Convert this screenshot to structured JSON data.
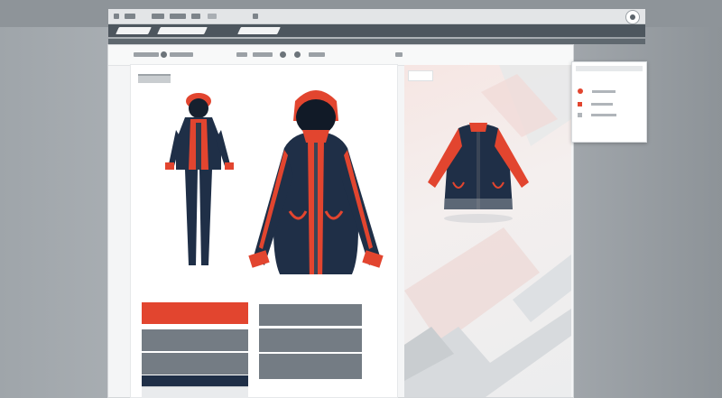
{
  "app": {
    "toolbar_chips": 7,
    "nav_pills": 3
  },
  "colors": {
    "accent": "#e2452f",
    "navy": "#1f2f47",
    "gray": "#747c84",
    "toolbar_dark": "#4d565e"
  },
  "icons": {
    "settings": "gear-icon",
    "header_dots": "circle-icon"
  },
  "buttons": {
    "left": [
      "",
      "",
      "",
      "",
      ""
    ],
    "right": [
      "",
      "",
      ""
    ]
  },
  "popup": {
    "items": [
      "",
      ""
    ]
  }
}
